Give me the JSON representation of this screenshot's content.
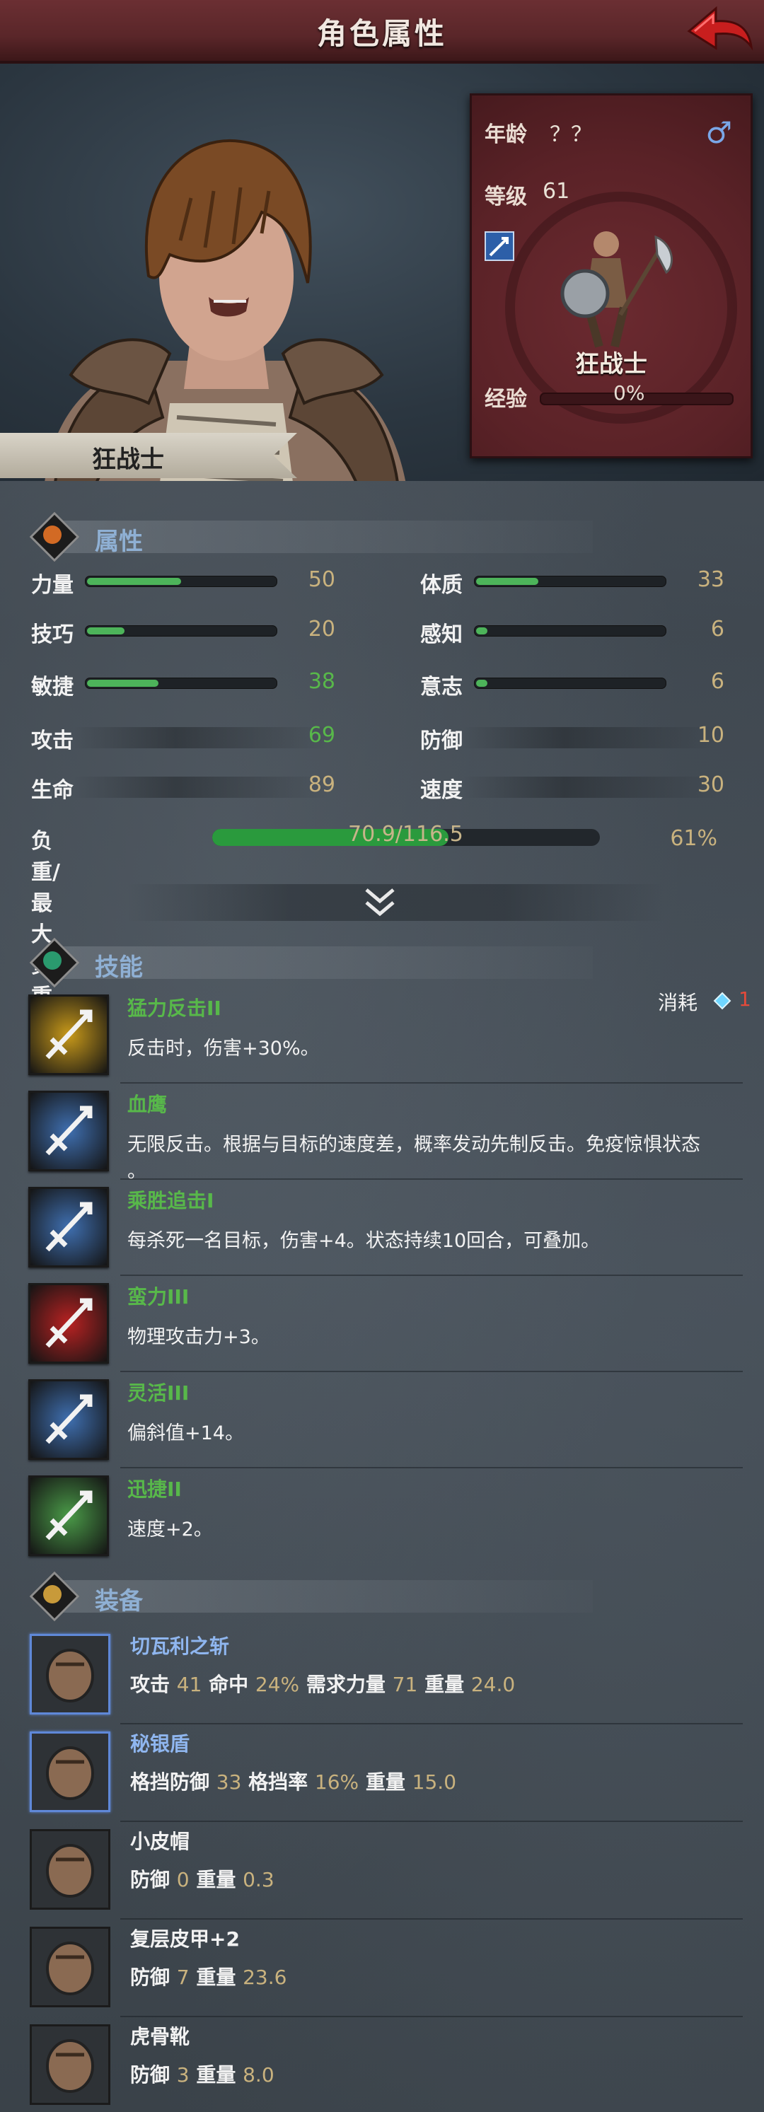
{
  "header": {
    "title": "角色属性",
    "back_label": ""
  },
  "character": {
    "name": "狂战士",
    "age_label": "年龄",
    "age_value": "？？",
    "gender_icon": "♂",
    "level_label": "等级",
    "level_value": "61",
    "class_name": "狂战士",
    "exp_label": "经验",
    "exp_value": "0%"
  },
  "sections": {
    "attributes": "属性",
    "skills": "技能",
    "equipment": "装备"
  },
  "attributes": [
    {
      "name": "力量",
      "value": "50",
      "fill": 0.5
    },
    {
      "name": "体质",
      "value": "33",
      "fill": 0.33
    },
    {
      "name": "技巧",
      "value": "20",
      "fill": 0.2
    },
    {
      "name": "感知",
      "value": "6",
      "fill": 0.06
    },
    {
      "name": "敏捷",
      "value": "38",
      "fill": 0.38
    },
    {
      "name": "意志",
      "value": "6",
      "fill": 0.06
    }
  ],
  "combat": [
    {
      "name": "攻击",
      "value": "69"
    },
    {
      "name": "防御",
      "value": "10"
    },
    {
      "name": "生命",
      "value": "89"
    },
    {
      "name": "速度",
      "value": "30"
    }
  ],
  "load": {
    "label": "负重/最大负重",
    "text": "70.9/116.5",
    "percent": "61%",
    "fill": 0.61
  },
  "skills": [
    {
      "name": "猛力反击II",
      "desc": "反击时，伤害+30%。",
      "desc2": ""
    },
    {
      "name": "血鹰",
      "desc": "无限反击。根据与目标的速度差，概率发动先制反击。免疫惊惧状态",
      "desc2": "。"
    },
    {
      "name": "乘胜追击I",
      "desc": "每杀死一名目标，伤害+4。状态持续10回合，可叠加。",
      "desc2": ""
    },
    {
      "name": "蛮力III",
      "desc": "物理攻击力+3。",
      "desc2": ""
    },
    {
      "name": "灵活III",
      "desc": "偏斜值+14。",
      "desc2": ""
    },
    {
      "name": "迅捷II",
      "desc": "速度+2。",
      "desc2": ""
    }
  ],
  "skill_cost": {
    "label": "消耗",
    "value": "1"
  },
  "equipment": [
    {
      "name": "切瓦利之斩",
      "stats": [
        [
          "攻击",
          "41"
        ],
        [
          "命中",
          "24%"
        ],
        [
          "需求力量",
          "71"
        ],
        [
          "重量",
          "24.0"
        ]
      ]
    },
    {
      "name": "秘银盾",
      "stats": [
        [
          "格挡防御",
          "33"
        ],
        [
          "格挡率",
          "16%"
        ],
        [
          "重量",
          "15.0"
        ]
      ]
    },
    {
      "name": "小皮帽",
      "stats": [
        [
          "防御",
          "0"
        ],
        [
          "重量",
          "0.3"
        ]
      ]
    },
    {
      "name": "复层皮甲+2",
      "stats": [
        [
          "防御",
          "7"
        ],
        [
          "重量",
          "23.6"
        ]
      ]
    },
    {
      "name": "虎骨靴",
      "stats": [
        [
          "防御",
          "3"
        ],
        [
          "重量",
          "8.0"
        ]
      ]
    }
  ],
  "colors": {
    "header": "#5a2629",
    "accent_green": "#4db45a",
    "skill_name": "#58b84a",
    "equip_blue": "#8fb6ef",
    "equip_white": "#f2f2f2",
    "stat_value": "#c9b27e"
  },
  "icons": {
    "back": "back-arrow-icon",
    "expand": "chevron-double-down-icon",
    "attributes": "person-icon",
    "skills": "star-icon",
    "equipment": "sword-icon",
    "cost": "gem-icon"
  }
}
